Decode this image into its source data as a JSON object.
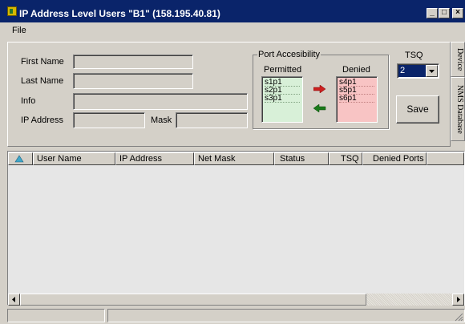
{
  "window": {
    "title": "IP Address Level Users \"B1\" (158.195.40.81)",
    "minimize_label": "_",
    "maximize_label": "□",
    "close_label": "×"
  },
  "menu": {
    "file": "File"
  },
  "form": {
    "first_name_label": "First Name",
    "first_name_value": "",
    "last_name_label": "Last Name",
    "last_name_value": "",
    "info_label": "Info",
    "info_value": "",
    "ip_address_label": "IP Address",
    "ip_address_value": "",
    "mask_label": "Mask",
    "mask_value": ""
  },
  "ports": {
    "group_label": "Port Accesibility",
    "permitted_label": "Permitted",
    "denied_label": "Denied",
    "permitted": [
      "s1p1",
      "s2p1",
      "s3p1"
    ],
    "denied": [
      "s4p1",
      "s5p1",
      "s6p1"
    ]
  },
  "tsq": {
    "label": "TSQ",
    "value": "2"
  },
  "save_label": "Save",
  "side_tabs": {
    "device": "Device",
    "nms_database": "NMS Database"
  },
  "table": {
    "columns": [
      "User Name",
      "IP Address",
      "Net Mask",
      "Status",
      "TSQ",
      "Denied Ports"
    ],
    "rows": []
  },
  "colors": {
    "titlebar": "#0a246a",
    "face": "#d4d0c8",
    "permitted_bg": "#d8f0d8",
    "denied_bg": "#f8c4c4",
    "table_bg": "#e6e6e6",
    "arrow_right": "#cc2020",
    "arrow_left": "#1a7a1a"
  }
}
